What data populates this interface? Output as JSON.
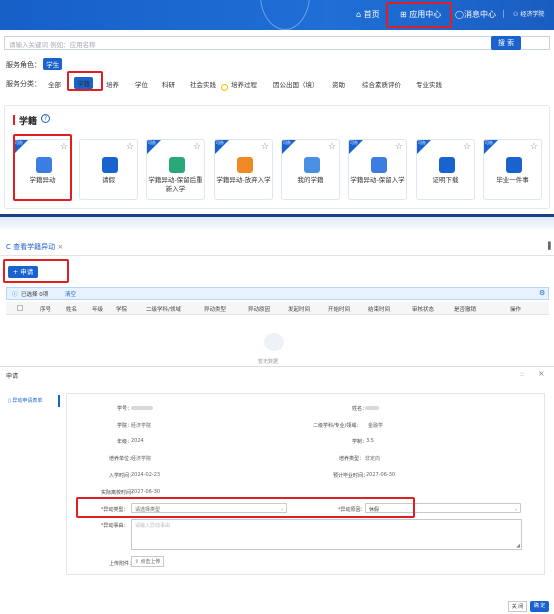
{
  "nav": {
    "home": "首页",
    "app_center": "应用中心",
    "messages": "消息中心",
    "school": "经济学院"
  },
  "search": {
    "placeholder": "请输入关键词 例如：应用名称",
    "button": "搜 索"
  },
  "service_role": {
    "label": "服务角色：",
    "value": "学生"
  },
  "service_category": {
    "label": "服务分类：",
    "items": [
      "全部",
      "学籍",
      "培养",
      "学位",
      "科研",
      "社会实践",
      "培养过程",
      "因公出国（境）",
      "资助",
      "综合素质评价",
      "专业实践"
    ]
  },
  "section": {
    "title": "学籍",
    "help_icon": "question-circle-icon"
  },
  "cards": [
    {
      "badge": "可办",
      "label": "学籍异动",
      "icon_color": "#3b7de0"
    },
    {
      "badge": "",
      "label": "请假",
      "icon_color": "#1a63cf"
    },
    {
      "badge": "可办",
      "label": "学籍异动-保留后重新入学",
      "icon_color": "#2aa87a"
    },
    {
      "badge": "可办",
      "label": "学籍异动-放弃入学",
      "icon_color": "#f08a24"
    },
    {
      "badge": "可办",
      "label": "我的学籍",
      "icon_color": "#4a90e2"
    },
    {
      "badge": "可办",
      "label": "学籍异动-保留入学",
      "icon_color": "#3b7de0"
    },
    {
      "badge": "可办",
      "label": "证明下载",
      "icon_color": "#1a63cf"
    },
    {
      "badge": "可办",
      "label": "毕业一件事",
      "icon_color": "#1a63cf"
    }
  ],
  "tab": {
    "title": "查看学籍异动",
    "close": "×"
  },
  "apply_button": "+ 申请",
  "selection": {
    "text": "已选择 0项",
    "clear": "清空"
  },
  "table_headers": [
    "序号",
    "姓名",
    "年级",
    "学院",
    "二级学科/领域",
    "异动类型",
    "异动原因",
    "发起时间",
    "开始时间",
    "结束时间",
    "审核状态",
    "是否撤销",
    "操作"
  ],
  "empty_text": "暂无数据",
  "dialog": {
    "title": "申请",
    "side_menu": "异动申请表单",
    "minimize": "::",
    "close": "×"
  },
  "form": {
    "student_id_label": "学号：",
    "name_label": "姓名：",
    "college_label": "学院：",
    "college_value": "经济学院",
    "discipline_label": "二级学科/专业/领域：",
    "discipline_value": "金融学",
    "grade_label": "年级：",
    "grade_value": "2024",
    "duration_label": "学制：",
    "duration_value": "3.5",
    "unit_label": "培养单位：",
    "unit_value": "经济学院",
    "type_label": "培养类型：",
    "type_value": "非定向",
    "enroll_label": "入学时间：",
    "enroll_value": "2024-02-23",
    "expected_grad_label": "预计毕业时间：",
    "expected_grad_value": "2027-06-30",
    "actual_grad_label": "实际离校时间：",
    "actual_grad_value": "2027-06-30",
    "change_type_label": "异动类型：",
    "change_type_placeholder": "请选择类型",
    "change_reason_label": "异动原因：",
    "change_reason_value": "休假",
    "reason_detail_label": "异动事由：",
    "reason_detail_placeholder": "请输入异动事由",
    "attachment_label": "上传附件：",
    "upload_button": "点击上传"
  },
  "footer": {
    "close": "关 闭",
    "confirm": "确 定"
  }
}
